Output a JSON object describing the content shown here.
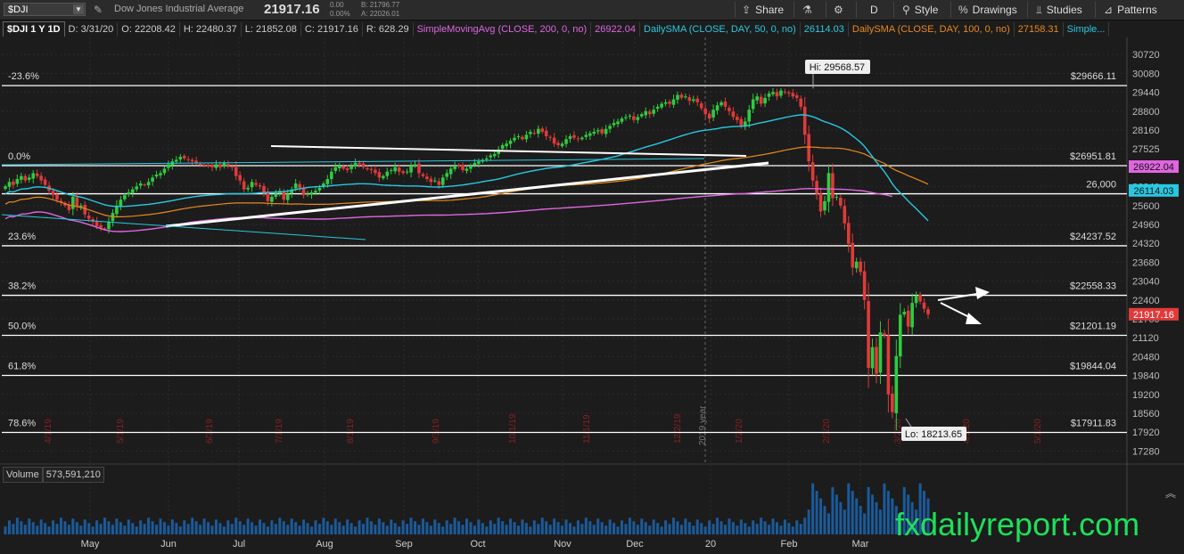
{
  "toolbar": {
    "symbol": "$DJI",
    "full_name": "Dow Jones Industrial Average",
    "last_price": "21917.16",
    "change": "0.00",
    "change_pct": "0.00%",
    "bid": "B: 21796.77",
    "ask": "A: 22026.01",
    "share_label": "Share",
    "period_label": "D",
    "style_label": "Style",
    "drawings_label": "Drawings",
    "studies_label": "Studies",
    "patterns_label": "Patterns",
    "icons": [
      "chevron-down-icon",
      "edit-icon",
      "share-icon",
      "flask-icon",
      "gear-icon",
      "style-icon",
      "drawings-icon",
      "studies-icon",
      "patterns-icon"
    ]
  },
  "infobar": {
    "symbol_period": "$DJI 1 Y 1D",
    "date": "D: 3/31/20",
    "open": "O: 22208.42",
    "high": "H: 22480.37",
    "low": "L: 21852.08",
    "close": "C: 21917.16",
    "range": "R: 628.29",
    "studies": [
      {
        "label": "SimpleMovingAvg (CLOSE, 200, 0, no)",
        "value": "26922.04",
        "color": "#e066e0"
      },
      {
        "label": "DailySMA (CLOSE, DAY, 50, 0, no)",
        "value": "26114.03",
        "color": "#28c8e0"
      },
      {
        "label": "DailySMA (CLOSE, DAY, 100, 0, no)",
        "value": "27158.31",
        "color": "#e8891c"
      },
      {
        "label": "Simple...",
        "value": "",
        "color": "#28c8e0"
      }
    ]
  },
  "chart_data": {
    "type": "candlestick",
    "title": "$DJI 1 Y 1D",
    "price_axis_ticks": [
      30720,
      30080,
      29440,
      28800,
      28160,
      27525,
      26880,
      26240,
      25600,
      24960,
      24320,
      23680,
      23040,
      22400,
      21760,
      21120,
      20480,
      19840,
      19200,
      18560,
      17920,
      17280
    ],
    "price_axis_labels": [
      "30720",
      "30080",
      "29440",
      "28800",
      "28160",
      "27525",
      "26880",
      "26240",
      "25600",
      "24960",
      "24320",
      "23680",
      "23040",
      "22400",
      "21760",
      "21120",
      "20480",
      "19840",
      "19200",
      "18560",
      "17920",
      "17280"
    ],
    "ylim": [
      16900,
      31300
    ],
    "time_axis_labels": [
      "May",
      "Jun",
      "Jul",
      "Aug",
      "Sep",
      "Oct",
      "Nov",
      "Dec",
      "20",
      "Feb",
      "Mar"
    ],
    "date_labels": [
      "4/1/19",
      "5/1/19",
      "6/3/19",
      "7/1/19",
      "8/1/19",
      "9/3/19",
      "10/1/19",
      "11/1/19",
      "12/2/19",
      "1/2/20",
      "2/3/20",
      "3/2/20",
      "4/1/20",
      "5/1/20"
    ],
    "year_separator_label": "2019 year",
    "fib_levels": [
      {
        "pct": "-23.6%",
        "value_label": "$29666.11",
        "price": 29666.11
      },
      {
        "pct": "0.0%",
        "value_label": "$26951.81",
        "price": 26951.81
      },
      {
        "pct": "",
        "value_label": "26,000",
        "price": 26000
      },
      {
        "pct": "23.6%",
        "value_label": "$24237.52",
        "price": 24237.52
      },
      {
        "pct": "38.2%",
        "value_label": "$22558.33",
        "price": 22558.33
      },
      {
        "pct": "50.0%",
        "value_label": "$21201.19",
        "price": 21201.19
      },
      {
        "pct": "61.8%",
        "value_label": "$19844.04",
        "price": 19844.04
      },
      {
        "pct": "78.6%",
        "value_label": "$17911.83",
        "price": 17911.83
      }
    ],
    "high_label": "Hi: 29568.57",
    "high": 29568.57,
    "low_label": "Lo: 18213.65",
    "low": 18213.65,
    "last_price_tag": "21917.16",
    "sma200_tag": "26922.04",
    "sma50_tag": "26114.03",
    "closes": [
      26250,
      26400,
      26300,
      26500,
      26600,
      26450,
      26550,
      26700,
      26600,
      26450,
      26300,
      26100,
      25950,
      25800,
      25700,
      25600,
      25450,
      25900,
      25550,
      25600,
      25300,
      25150,
      25050,
      24900,
      24850,
      24800,
      25050,
      25350,
      25600,
      25800,
      25950,
      26050,
      26150,
      26250,
      26350,
      26300,
      26400,
      26550,
      26650,
      26700,
      26850,
      27000,
      27100,
      27150,
      27250,
      27200,
      27150,
      27100,
      27050,
      27000,
      26950,
      26950,
      26900,
      27000,
      26900,
      27050,
      26950,
      26900,
      26600,
      26450,
      26150,
      26200,
      26400,
      26300,
      26250,
      26000,
      25750,
      25900,
      26000,
      26100,
      25800,
      26000,
      26150,
      26350,
      26200,
      25950,
      26000,
      26050,
      26100,
      26200,
      26350,
      26500,
      26750,
      26900,
      26950,
      26850,
      26800,
      26950,
      27050,
      27000,
      26900,
      26850,
      26800,
      26700,
      26550,
      26600,
      26750,
      26800,
      26900,
      26750,
      26700,
      26750,
      26950,
      27000,
      26700,
      26600,
      26500,
      26400,
      26450,
      26300,
      26550,
      26700,
      26850,
      26950,
      26950,
      26800,
      26850,
      26950,
      27050,
      27100,
      27150,
      27200,
      27300,
      27350,
      27500,
      27650,
      27700,
      27800,
      27900,
      27950,
      27850,
      28000,
      28100,
      28050,
      28200,
      28100,
      27950,
      27900,
      27700,
      27650,
      27700,
      27850,
      27950,
      27900,
      27850,
      27900,
      28000,
      28050,
      28100,
      28150,
      28050,
      28200,
      28300,
      28400,
      28450,
      28550,
      28600,
      28650,
      28500,
      28600,
      28700,
      28800,
      28700,
      28850,
      28950,
      29050,
      29100,
      29050,
      29200,
      29350,
      29250,
      29300,
      29150,
      29200,
      29100,
      28900,
      28700,
      28550,
      28850,
      29000,
      29100,
      28950,
      28800,
      28600,
      28500,
      28300,
      28450,
      28850,
      29200,
      29300,
      29050,
      29250,
      29400,
      29450,
      29300,
      29500,
      29450,
      29400,
      29300,
      29250,
      28950,
      28000,
      27100,
      26450,
      26000,
      25400,
      25750,
      26700,
      25850,
      25900,
      25600,
      25000,
      24300,
      23500,
      23700,
      23350,
      22400,
      20100,
      20800,
      19900,
      21300,
      21200,
      19200,
      18600,
      20500,
      21900,
      22000,
      21500,
      22300,
      22550,
      22350,
      22100,
      21917
    ]
  },
  "volume": {
    "label": "Volume",
    "value": "573,591,210"
  },
  "watermark": "fxdailyreport.com",
  "colors": {
    "background": "#1c1c1c",
    "up": "#2ecc40",
    "down": "#e03a3a",
    "sma50": "#28c8e0",
    "sma100": "#e8891c",
    "sma200": "#e066e0",
    "fib": "#ffffff",
    "watermark": "#1ee05a"
  }
}
